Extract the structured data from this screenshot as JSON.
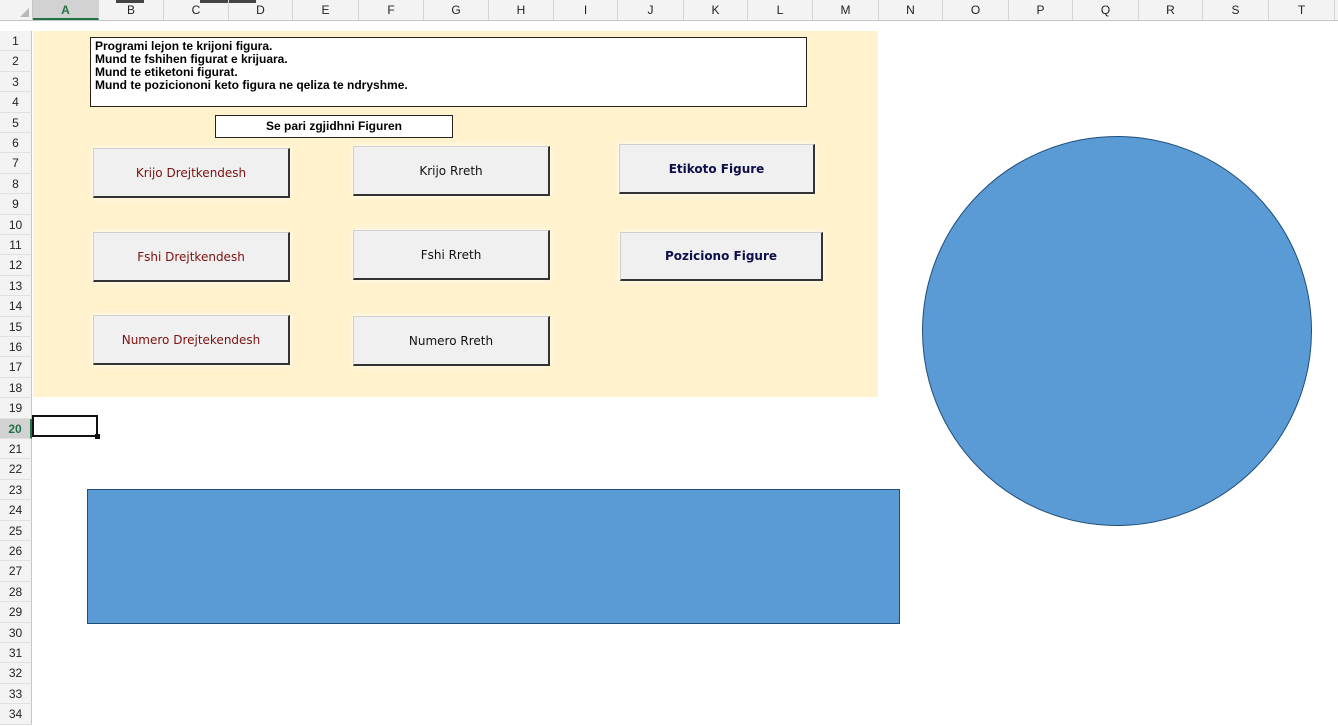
{
  "columns": [
    "A",
    "B",
    "C",
    "D",
    "E",
    "F",
    "G",
    "H",
    "I",
    "J",
    "K",
    "L",
    "M",
    "N",
    "O",
    "P",
    "Q",
    "R",
    "S",
    "T"
  ],
  "active_column": "A",
  "rows": [
    "1",
    "2",
    "3",
    "4",
    "5",
    "6",
    "7",
    "8",
    "9",
    "10",
    "11",
    "12",
    "13",
    "14",
    "15",
    "16",
    "17",
    "18",
    "19",
    "20",
    "21",
    "22",
    "23",
    "24",
    "25",
    "26",
    "27",
    "28",
    "29",
    "30",
    "31",
    "32",
    "33",
    "34"
  ],
  "active_row": "20",
  "info_text": {
    "line1": "Programi lejon te krijoni figura.",
    "line2": "Mund te fshihen figurat e krijuara.",
    "line3": "Mund te etiketoni figurat.",
    "line4": "Mund te poziciononi keto figura ne qeliza te ndryshme."
  },
  "select_label": "Se pari zgjidhni Figuren",
  "buttons": {
    "create_rectangle": "Krijo Drejtkendesh",
    "create_circle": "Krijo Rreth",
    "label_shape": "Etikoto Figure",
    "delete_rectangle": "Fshi Drejtkendesh",
    "delete_circle": "Fshi Rreth",
    "position_shape": "Poziciono Figure",
    "count_rectangle": "Numero Drejtekendesh",
    "count_circle": "Numero Rreth"
  },
  "colors": {
    "panel_background": "#fff2cc",
    "shape_fill": "#5b9bd5",
    "shape_border": "#1f4e79",
    "button_text_maroon": "#7b1111",
    "button_text_navy": "#0e0e4a"
  }
}
